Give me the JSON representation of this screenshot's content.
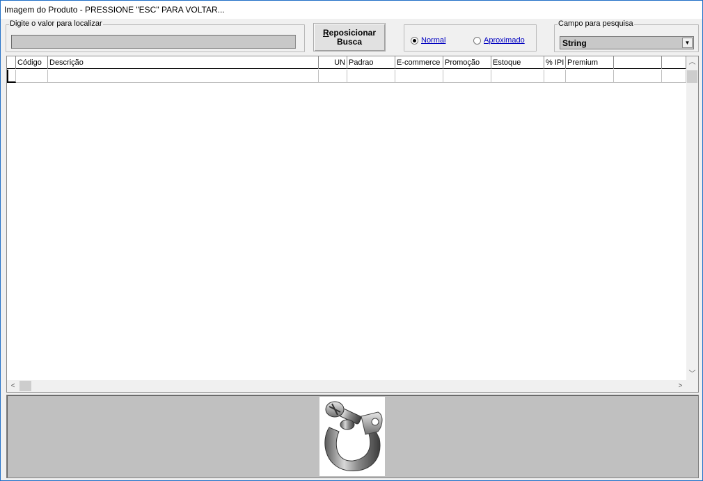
{
  "window": {
    "title": "Imagem do Produto - PRESSIONE \"ESC\" PARA VOLTAR..."
  },
  "search": {
    "group_label": "Digite o valor para localizar",
    "value": ""
  },
  "reposition_button": {
    "line1": "Reposicionar",
    "line2": "Busca"
  },
  "mode": {
    "options": [
      {
        "label": "Normal",
        "selected": true
      },
      {
        "label": "Aproximado",
        "selected": false
      }
    ]
  },
  "search_field": {
    "group_label": "Campo para pesquisa",
    "selected": "String"
  },
  "table": {
    "columns": [
      "",
      "Código",
      "Descrição",
      "UN",
      "Padrao",
      "E-commerce",
      "Promoção",
      "Estoque",
      "% IPI",
      "Premium",
      "",
      ""
    ],
    "rows": [
      [
        "",
        "",
        "",
        "",
        "",
        "",
        "",
        "",
        "",
        "",
        "",
        ""
      ]
    ]
  },
  "product_image": {
    "icon": "pipe-clamp-image"
  }
}
